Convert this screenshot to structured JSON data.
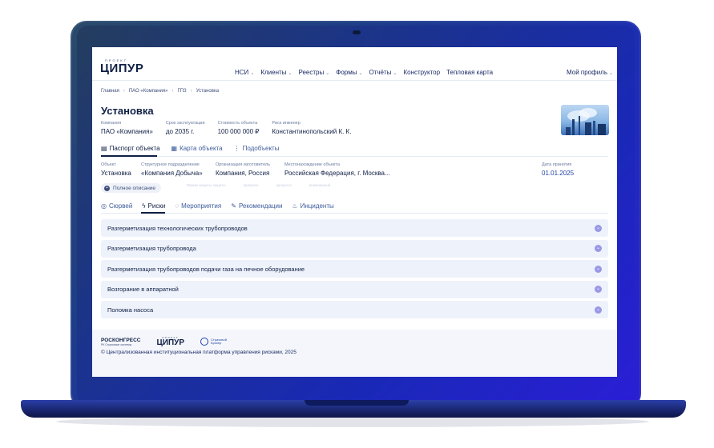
{
  "logo": {
    "small": "ПРОЕКТ",
    "big": "ЦИПУР"
  },
  "nav": {
    "items": [
      {
        "label": "НСИ",
        "dropdown": true
      },
      {
        "label": "Клиенты",
        "dropdown": true
      },
      {
        "label": "Реестры",
        "dropdown": true
      },
      {
        "label": "Формы",
        "dropdown": true
      },
      {
        "label": "Отчёты",
        "dropdown": true
      },
      {
        "label": "Конструктор",
        "dropdown": false
      },
      {
        "label": "Тепловая карта",
        "dropdown": false
      }
    ],
    "profile": "Мой профиль"
  },
  "breadcrumbs": [
    "Главная",
    "ПАО «Компания»",
    "ГПЗ",
    "Установка"
  ],
  "page_title": "Установка",
  "meta": [
    {
      "label": "Компания",
      "value": "ПАО «Компания»"
    },
    {
      "label": "Срок эксплуатации",
      "value": "до 2035 г."
    },
    {
      "label": "Стоимость объекта",
      "value": "100 000 000 ₽"
    },
    {
      "label": "Риск инженер",
      "value": "Константинопольский К. К."
    }
  ],
  "object_tabs": [
    {
      "label": "Паспорт объекта",
      "icon": "document-icon",
      "active": true
    },
    {
      "label": "Карта объекта",
      "icon": "map-icon",
      "active": false
    },
    {
      "label": "Подобъекты",
      "icon": "hierarchy-icon",
      "active": false
    }
  ],
  "details": [
    {
      "label": "Объект",
      "value": "Установка"
    },
    {
      "label": "Структурное подразделение",
      "value": "«Компания Добыча»"
    },
    {
      "label": "Организация изготовитель",
      "value": "Компания, Россия"
    },
    {
      "label": "Местонахождение объекта",
      "value": "Российская Федерация, г. Москва..."
    },
    {
      "label": "Дата принятия",
      "value": "01.01.2025"
    }
  ],
  "faded_labels": [
    "Режим защиты защиты",
    "пропуско",
    "процесса",
    "инженерный"
  ],
  "full_description": "Полное описание",
  "section_tabs": [
    {
      "label": "Сюрвей",
      "icon": "survey-icon",
      "active": false
    },
    {
      "label": "Риски",
      "icon": "lightning-icon",
      "active": true
    },
    {
      "label": "Мероприятия",
      "icon": "chat-icon",
      "active": false
    },
    {
      "label": "Рекомендации",
      "icon": "edit-icon",
      "active": false
    },
    {
      "label": "Инциденты",
      "icon": "fire-icon",
      "active": false
    }
  ],
  "risks": [
    "Разгерметизация технологических трубопроводов",
    "Разгерметизация трубопровода",
    "Разгерметизация трубопроводов подачи газа на печное оборудование",
    "Возгорание в аппаратной",
    "Поломка насоса"
  ],
  "footer": {
    "roscongress": "РОСКОНГРЕСС",
    "roscongress_sub": "РК Страховые системы",
    "cipur_small": "ПРОЕКТ",
    "cipur": "ЦИПУР",
    "strah_line1": "Страховой",
    "strah_line2": "Брокер",
    "copyright": "© Централизованная институциональная платформа управления рисками, 2025"
  },
  "colors": {
    "accent": "#0f1f45",
    "link": "#2144a8",
    "risk_row": "#eef2fb",
    "toggle": "#9a98e6"
  }
}
